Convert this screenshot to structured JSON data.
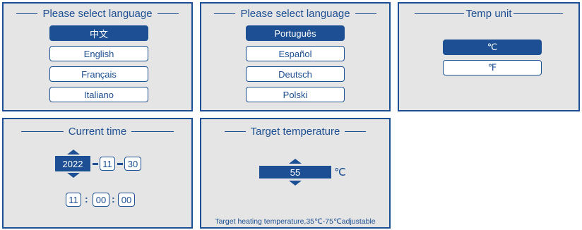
{
  "panels": {
    "language1": {
      "title": "Please select language",
      "options": [
        "中文",
        "English",
        "Français",
        "Italiano"
      ]
    },
    "language2": {
      "title": "Please select language",
      "options": [
        "Português",
        "Español",
        "Deutsch",
        "Polski"
      ]
    },
    "temp_unit": {
      "title": "Temp unit",
      "options": [
        "℃",
        "℉"
      ]
    },
    "current_time": {
      "title": "Current time",
      "date": {
        "year": "2022",
        "month": "11",
        "day": "30"
      },
      "time": {
        "hour": "11",
        "minute": "00",
        "second": "00"
      },
      "time_separator": ":"
    },
    "target_temp": {
      "title": "Target temperature",
      "value": "55",
      "unit": "℃",
      "note": "Target heating temperature,35℃-75℃adjustable"
    }
  },
  "colors": {
    "accent": "#1c4f93",
    "panel_bg": "#e5e5e5",
    "field_bg": "#ffffff"
  },
  "icons": {
    "increase": "caret-up-icon",
    "decrease": "caret-down-icon"
  }
}
